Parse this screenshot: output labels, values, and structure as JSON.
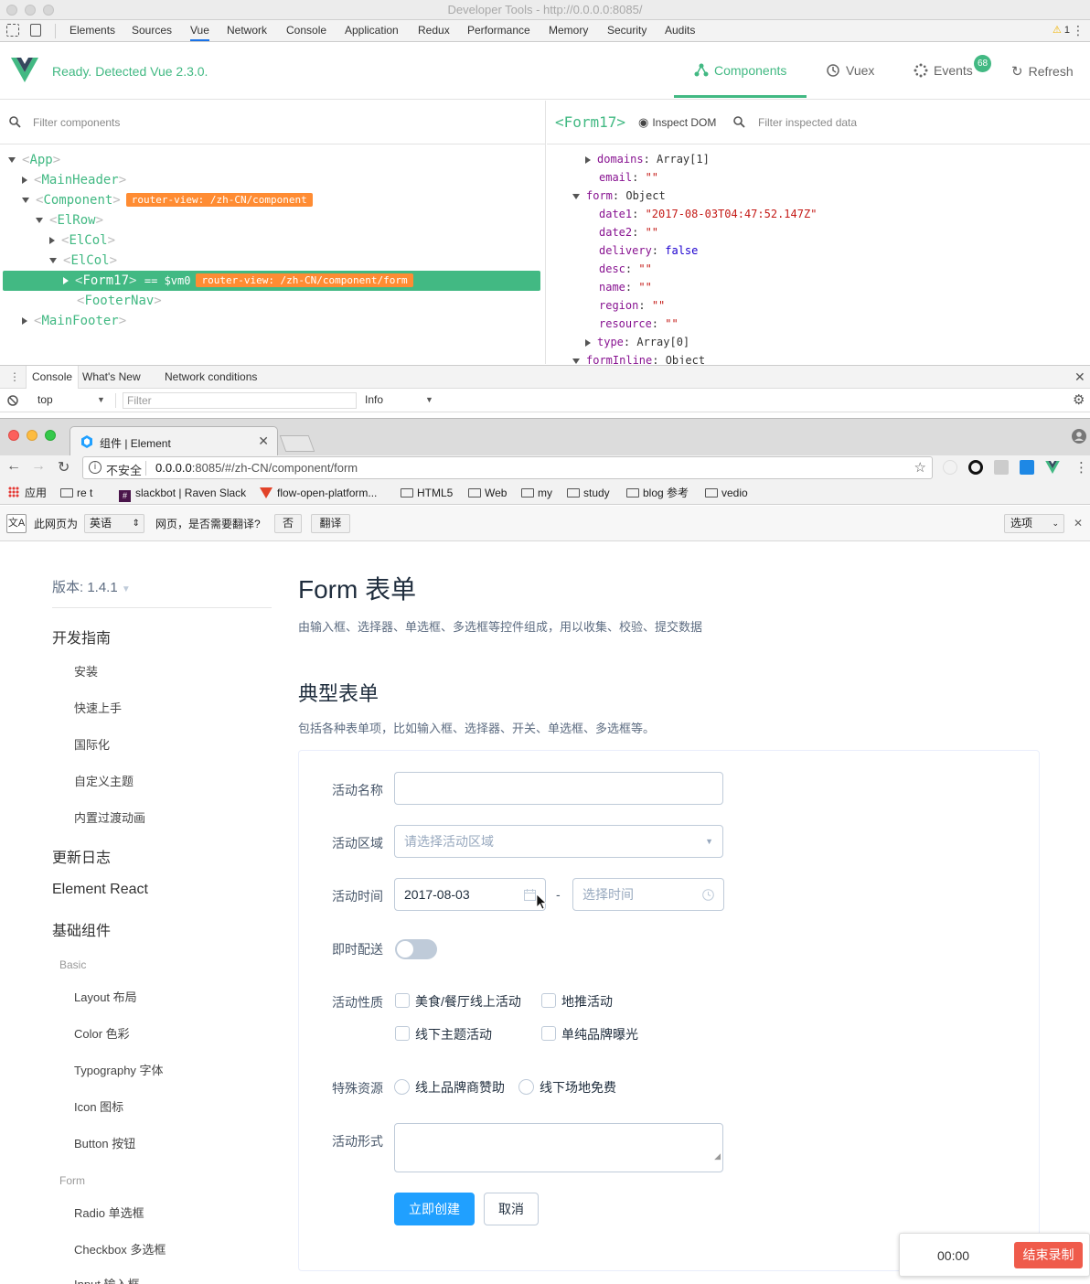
{
  "devtools": {
    "window_title": "Developer Tools - http://0.0.0.0:8085/",
    "tabs": [
      "Elements",
      "Sources",
      "Vue",
      "Network",
      "Console",
      "Application",
      "Redux",
      "Performance",
      "Memory",
      "Security",
      "Audits"
    ],
    "active_tab": "Vue",
    "warning_count": "1"
  },
  "vue": {
    "status": "Ready. Detected Vue 2.3.0.",
    "nav": {
      "components": "Components",
      "vuex": "Vuex",
      "events": "Events",
      "events_count": "68",
      "refresh": "Refresh"
    },
    "brand_color": "#42b983"
  },
  "tree": {
    "filter_placeholder": "Filter components",
    "nodes": [
      {
        "name": "App"
      },
      {
        "name": "MainHeader"
      },
      {
        "name": "Component",
        "tag": "router-view: /zh-CN/component"
      },
      {
        "name": "ElRow"
      },
      {
        "name": "ElCol"
      },
      {
        "name": "ElCol"
      },
      {
        "name": "Form17",
        "suffix": "== $vm0",
        "tag": "router-view: /zh-CN/component/form"
      },
      {
        "name": "FooterNav"
      },
      {
        "name": "MainFooter"
      }
    ]
  },
  "inspector": {
    "component": "<Form17>",
    "inspect_dom": "Inspect DOM",
    "filter_placeholder": "Filter inspected data",
    "lines": [
      {
        "key": "domains",
        "value": "Array[1]"
      },
      {
        "key": "email",
        "value": "\"\""
      },
      {
        "key": "form",
        "value": "Object"
      },
      {
        "key": "date1",
        "value": "\"2017-08-03T04:47:52.147Z\""
      },
      {
        "key": "date2",
        "value": "\"\""
      },
      {
        "key": "delivery",
        "value": "false"
      },
      {
        "key": "desc",
        "value": "\"\""
      },
      {
        "key": "name",
        "value": "\"\""
      },
      {
        "key": "region",
        "value": "\"\""
      },
      {
        "key": "resource",
        "value": "\"\""
      },
      {
        "key": "type",
        "value": "Array[0]"
      },
      {
        "key": "formInline",
        "value": "Object"
      }
    ]
  },
  "drawer": {
    "tabs": [
      "Console",
      "What's New",
      "Network conditions"
    ],
    "context": "top",
    "filter_placeholder": "Filter",
    "level": "Info"
  },
  "browser": {
    "tab_title": "组件 | Element",
    "insecure": "不安全",
    "url_host": "0.0.0.0",
    "url_rest": ":8085/#/zh-CN/component/form",
    "bookmarks": [
      "应用",
      "re  t",
      "slackbot | Raven Slack",
      "flow-open-platform...",
      "HTML5",
      "Web",
      "my",
      "study",
      "blog 参考",
      "vedio"
    ],
    "translate": {
      "prefix": "此网页为",
      "lang": "英语",
      "question": "网页，是否需要翻译?",
      "no": "否",
      "yes": "翻译",
      "options": "选项"
    }
  },
  "page": {
    "version": "版本:  1.4.1",
    "sidebar": {
      "guide": "开发指南",
      "guide_items": [
        "安装",
        "快速上手",
        "国际化",
        "自定义主题",
        "内置过渡动画"
      ],
      "changelog": "更新日志",
      "react": "Element React",
      "basic_components": "基础组件",
      "basic_group": "Basic",
      "basic_items": [
        "Layout 布局",
        "Color 色彩",
        "Typography 字体",
        "Icon 图标",
        "Button 按钮"
      ],
      "form_group": "Form",
      "form_items": [
        "Radio 单选框",
        "Checkbox 多选框",
        "Input 输入框"
      ]
    },
    "title": "Form 表单",
    "subtitle": "由输入框、选择器、单选框、多选框等控件组成，用以收集、校验、提交数据",
    "section_title": "典型表单",
    "section_desc": "包括各种表单项，比如输入框、选择器、开关、单选框、多选框等。",
    "form": {
      "name_label": "活动名称",
      "region_label": "活动区域",
      "region_placeholder": "请选择活动区域",
      "time_label": "活动时间",
      "date_value": "2017-08-03",
      "time_placeholder": "选择时间",
      "dash": "-",
      "delivery_label": "即时配送",
      "type_label": "活动性质",
      "type_options": [
        "美食/餐厅线上活动",
        "地推活动",
        "线下主题活动",
        "单纯品牌曝光"
      ],
      "resource_label": "特殊资源",
      "resource_options": [
        "线上品牌商赞助",
        "线下场地免费"
      ],
      "desc_label": "活动形式",
      "submit": "立即创建",
      "cancel": "取消"
    }
  },
  "recorder": {
    "time": "00:00",
    "stop": "结束录制"
  }
}
